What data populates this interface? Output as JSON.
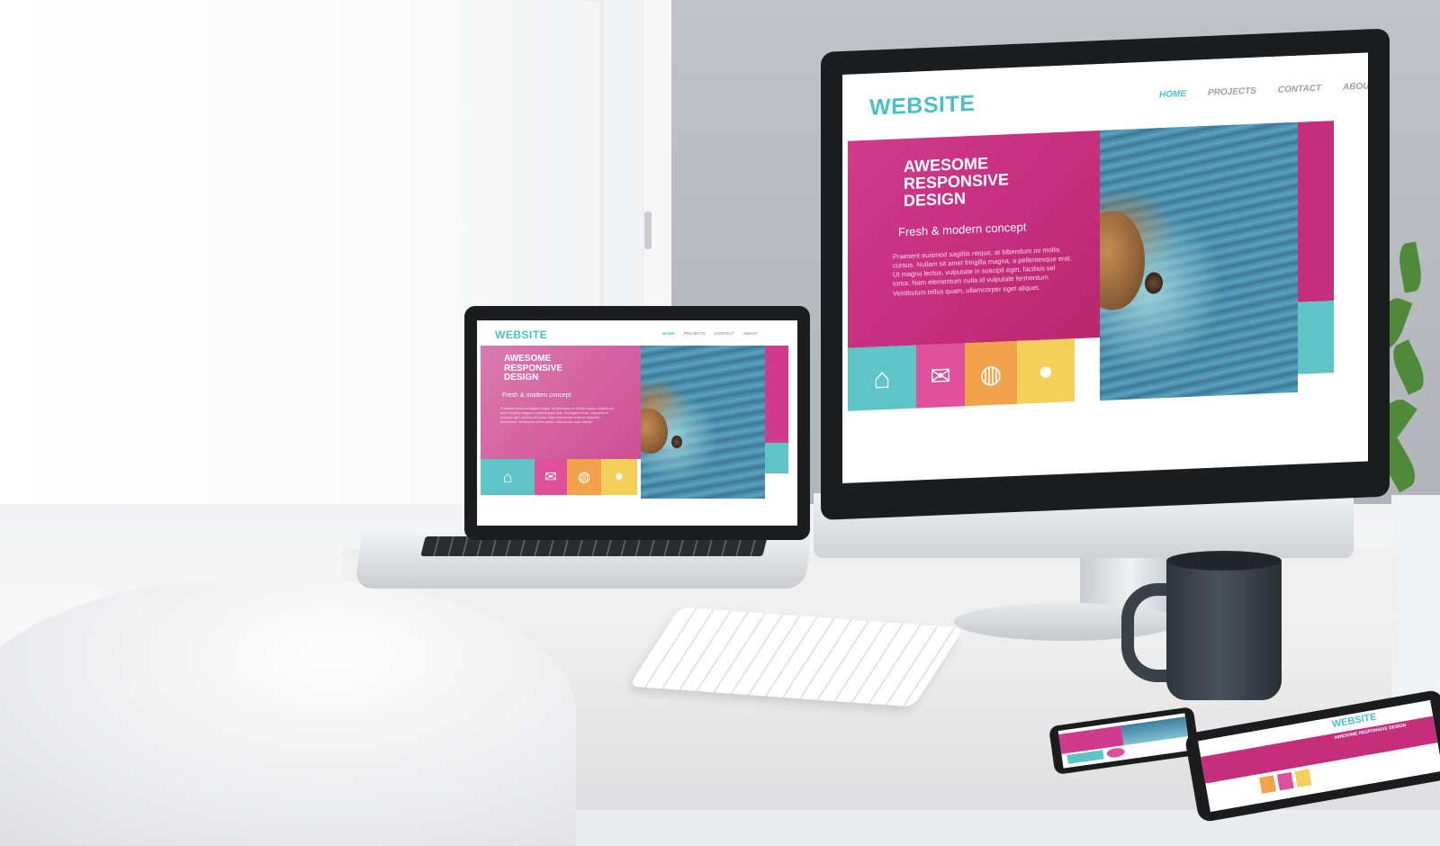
{
  "monitor": {
    "site": {
      "logo": "WEBSITE",
      "nav": [
        "HOME",
        "PROJECTS",
        "CONTACT",
        "ABOUT"
      ],
      "hero_title": [
        "AWESOME",
        "RESPONSIVE",
        "DESIGN"
      ],
      "hero_subtitle": "Fresh & modern concept",
      "hero_body": "Praesent euismod sagittis neque, at bibendum mi mollis cursus. Nullam sit amet fringilla magna, a pellentesque erat. Ut magna lectus, vulputate in suscipit eget, facilisis vel tortor. Nam elementum nulla id vulputate fermentum. Vestibulum tellus quam, ullamcorper eget aliquet."
    }
  },
  "laptop": {
    "site": {
      "logo": "WEBSITE",
      "nav": [
        "HOME",
        "PROJECTS",
        "CONTACT",
        "ABOUT"
      ],
      "hero_title": [
        "AWESOME",
        "RESPONSIVE",
        "DESIGN"
      ],
      "hero_subtitle": "Fresh & modern concept",
      "hero_body": "Praesent euismod sagittis neque, at bibendum mi mollis cursus. Nullam sit amet fringilla magna, a pellentesque erat. Ut magna lectus, vulputate in suscipit eget, facilisis vel tortor. Nam elementum nulla id vulputate fermentum. Vestibulum tellus quam, ullamcorper eget aliquet."
    }
  },
  "tablet": {
    "logo": "WEBSITE",
    "hero_title": "AWESOME RESPONSIVE DESIGN"
  },
  "colors": {
    "accent_teal": "#4bc0c4",
    "hero_magenta": "#c52d7d",
    "tile_teal": "#5fc4c5",
    "tile_pink": "#e04f9a",
    "tile_orange": "#f1a24a",
    "tile_yellow": "#f4cf5a"
  },
  "icons": [
    "home-icon",
    "mail-icon",
    "globe-icon",
    "user-icon"
  ]
}
